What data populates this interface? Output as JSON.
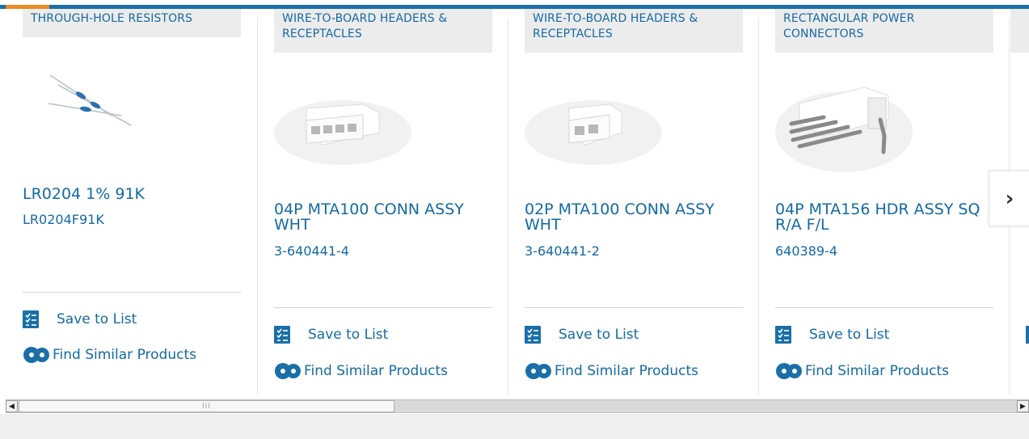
{
  "colors": {
    "link": "#146aa2",
    "accent_orange": "#e98a24",
    "brand_blue": "#1a6fa8",
    "category_bg": "#ececec"
  },
  "cards": [
    {
      "category": "THROUGH-HOLE RESISTORS",
      "name": "LR0204 1% 91K",
      "part_number": "LR0204F91K",
      "image": "resistors-image",
      "save_label": "Save to List",
      "similar_label": "Find Similar Products"
    },
    {
      "category": "WIRE-TO-BOARD HEADERS & RECEPTACLES",
      "name": "04P MTA100 CONN ASSY WHT",
      "part_number": "3-640441-4",
      "image": "connector-4pin-image",
      "save_label": "Save to List",
      "similar_label": "Find Similar Products"
    },
    {
      "category": "WIRE-TO-BOARD HEADERS & RECEPTACLES",
      "name": "02P MTA100 CONN ASSY WHT",
      "part_number": "3-640441-2",
      "image": "connector-2pin-image",
      "save_label": "Save to List",
      "similar_label": "Find Similar Products"
    },
    {
      "category": "RECTANGULAR POWER CONNECTORS",
      "name": "04P MTA156 HDR ASSY SQ R/A F/L",
      "part_number": "640389-4",
      "image": "header-ra-image",
      "save_label": "Save to List",
      "similar_label": "Find Similar Products"
    }
  ],
  "carousel": {
    "next_icon": "chevron-right-icon",
    "next_glyph": "›"
  },
  "scrollbar": {
    "left_arrow": "◀",
    "right_arrow": "▶",
    "grip": "III"
  }
}
